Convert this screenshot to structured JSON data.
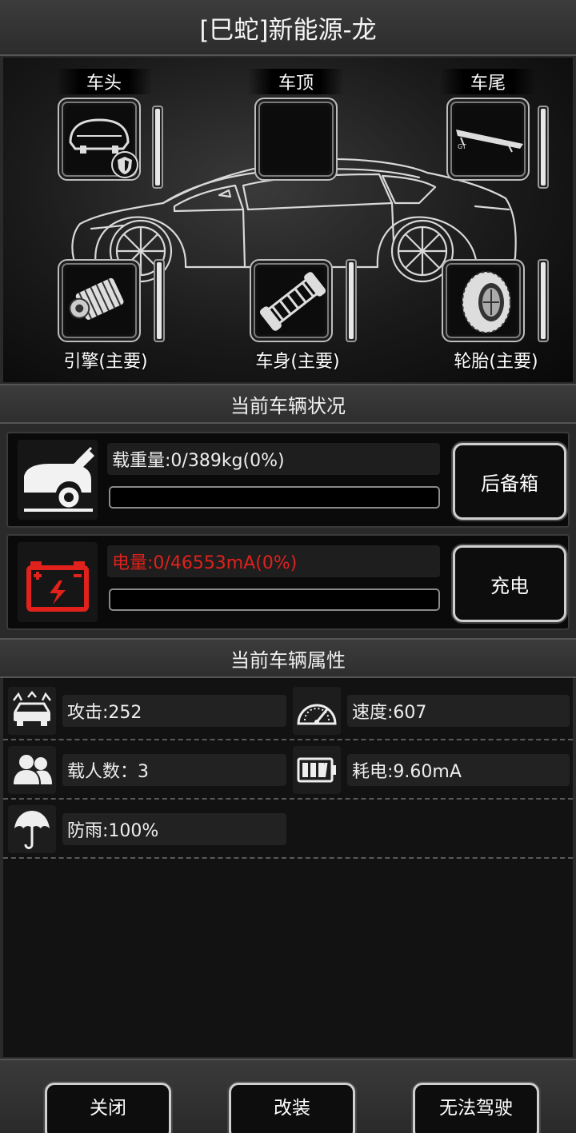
{
  "header": {
    "title": "[巳蛇]新能源-龙"
  },
  "slots": {
    "front": {
      "label": "车头",
      "icon": "car-front-part-icon",
      "badge": "shield-badge-icon",
      "durability": 1.0
    },
    "roof": {
      "label": "车顶",
      "icon": "empty-slot-icon",
      "durability": 1.0
    },
    "rear": {
      "label": "车尾",
      "icon": "rear-spoiler-icon",
      "durability": 1.0
    },
    "engine": {
      "label": "引擎(主要)",
      "icon": "engine-icon",
      "durability": 1.0
    },
    "body": {
      "label": "车身(主要)",
      "icon": "chassis-icon",
      "durability": 1.0
    },
    "tire": {
      "label": "轮胎(主要)",
      "icon": "tire-icon",
      "durability": 1.0
    }
  },
  "status": {
    "title": "当前车辆状况",
    "load": {
      "text": "载重量:0/389kg(0%)",
      "value": 0,
      "button": "后备箱",
      "icon": "car-trunk-icon"
    },
    "power": {
      "text": "电量:0/46553mA(0%)",
      "value": 0,
      "button": "充电",
      "icon": "battery-icon",
      "color": "#e0211c"
    }
  },
  "attributes": {
    "title": "当前车辆属性",
    "attack": {
      "text": "攻击:252",
      "icon": "car-attack-icon"
    },
    "speed": {
      "text": "速度:607",
      "icon": "speedometer-icon"
    },
    "passengers": {
      "text": "载人数：3",
      "icon": "people-icon"
    },
    "consumption": {
      "text": "耗电:9.60mA",
      "icon": "battery-level-icon"
    },
    "rainproof": {
      "text": "防雨:100%",
      "icon": "umbrella-icon"
    }
  },
  "footer": {
    "close": "关闭",
    "modify": "改装",
    "drive": "无法驾驶"
  }
}
